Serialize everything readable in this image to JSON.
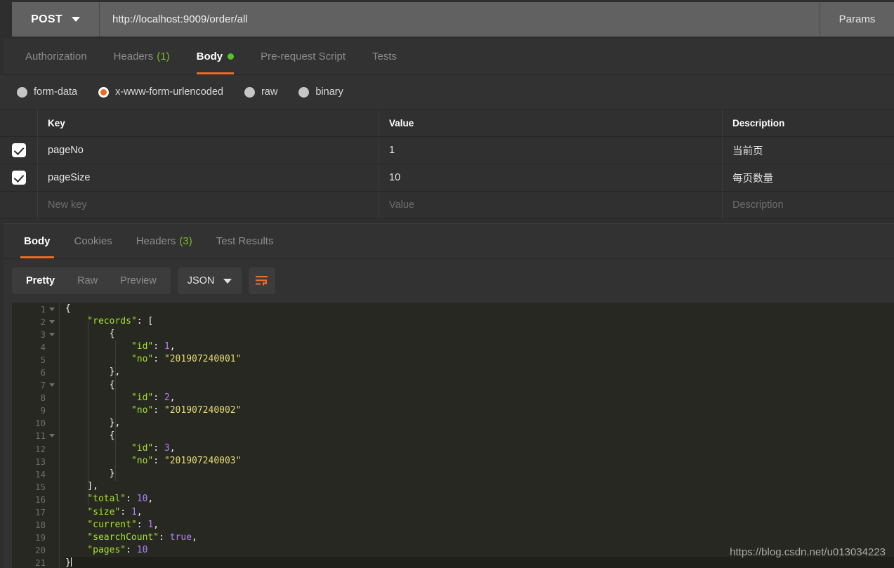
{
  "request_bar": {
    "method": "POST",
    "method_chevron_icon": "chevron-down-icon",
    "url": "http://localhost:9009/order/all",
    "params_label": "Params"
  },
  "request_tabs": [
    {
      "label": "Authorization",
      "count": "",
      "active": false,
      "dot": false
    },
    {
      "label": "Headers",
      "count": "(1)",
      "active": false,
      "dot": false
    },
    {
      "label": "Body",
      "count": "",
      "active": true,
      "dot": true
    },
    {
      "label": "Pre-request Script",
      "count": "",
      "active": false,
      "dot": false
    },
    {
      "label": "Tests",
      "count": "",
      "active": false,
      "dot": false
    }
  ],
  "body_types": [
    {
      "label": "form-data",
      "selected": false
    },
    {
      "label": "x-www-form-urlencoded",
      "selected": true
    },
    {
      "label": "raw",
      "selected": false
    },
    {
      "label": "binary",
      "selected": false
    }
  ],
  "param_table": {
    "headers": {
      "key": "Key",
      "value": "Value",
      "description": "Description"
    },
    "rows": [
      {
        "checked": true,
        "key": "pageNo",
        "value": "1",
        "description": "当前页"
      },
      {
        "checked": true,
        "key": "pageSize",
        "value": "10",
        "description": "每页数量"
      }
    ],
    "new_row_placeholders": {
      "key": "New key",
      "value": "Value",
      "description": "Description"
    }
  },
  "response_tabs": [
    {
      "label": "Body",
      "count": "",
      "active": true
    },
    {
      "label": "Cookies",
      "count": "",
      "active": false
    },
    {
      "label": "Headers",
      "count": "(3)",
      "active": false
    },
    {
      "label": "Test Results",
      "count": "",
      "active": false
    }
  ],
  "view_toolbar": {
    "modes": [
      {
        "label": "Pretty",
        "active": true
      },
      {
        "label": "Raw",
        "active": false
      },
      {
        "label": "Preview",
        "active": false
      }
    ],
    "format": "JSON",
    "format_chevron_icon": "chevron-down-icon",
    "wrap_icon": "word-wrap-icon"
  },
  "response_body": {
    "lines": [
      {
        "n": 1,
        "fold": true,
        "current": false,
        "tokens": [
          {
            "t": "pun",
            "v": "{"
          }
        ]
      },
      {
        "n": 2,
        "fold": true,
        "current": false,
        "tokens": [
          {
            "t": "pun",
            "v": "    "
          },
          {
            "t": "key",
            "v": "\"records\""
          },
          {
            "t": "pun",
            "v": ": ["
          }
        ]
      },
      {
        "n": 3,
        "fold": true,
        "current": false,
        "tokens": [
          {
            "t": "pun",
            "v": "        {"
          }
        ]
      },
      {
        "n": 4,
        "fold": false,
        "current": false,
        "tokens": [
          {
            "t": "pun",
            "v": "            "
          },
          {
            "t": "key",
            "v": "\"id\""
          },
          {
            "t": "pun",
            "v": ": "
          },
          {
            "t": "num",
            "v": "1"
          },
          {
            "t": "pun",
            "v": ","
          }
        ]
      },
      {
        "n": 5,
        "fold": false,
        "current": false,
        "tokens": [
          {
            "t": "pun",
            "v": "            "
          },
          {
            "t": "key",
            "v": "\"no\""
          },
          {
            "t": "pun",
            "v": ": "
          },
          {
            "t": "str",
            "v": "\"201907240001\""
          }
        ]
      },
      {
        "n": 6,
        "fold": false,
        "current": false,
        "tokens": [
          {
            "t": "pun",
            "v": "        },"
          }
        ]
      },
      {
        "n": 7,
        "fold": true,
        "current": false,
        "tokens": [
          {
            "t": "pun",
            "v": "        {"
          }
        ]
      },
      {
        "n": 8,
        "fold": false,
        "current": false,
        "tokens": [
          {
            "t": "pun",
            "v": "            "
          },
          {
            "t": "key",
            "v": "\"id\""
          },
          {
            "t": "pun",
            "v": ": "
          },
          {
            "t": "num",
            "v": "2"
          },
          {
            "t": "pun",
            "v": ","
          }
        ]
      },
      {
        "n": 9,
        "fold": false,
        "current": false,
        "tokens": [
          {
            "t": "pun",
            "v": "            "
          },
          {
            "t": "key",
            "v": "\"no\""
          },
          {
            "t": "pun",
            "v": ": "
          },
          {
            "t": "str",
            "v": "\"201907240002\""
          }
        ]
      },
      {
        "n": 10,
        "fold": false,
        "current": false,
        "tokens": [
          {
            "t": "pun",
            "v": "        },"
          }
        ]
      },
      {
        "n": 11,
        "fold": true,
        "current": false,
        "tokens": [
          {
            "t": "pun",
            "v": "        {"
          }
        ]
      },
      {
        "n": 12,
        "fold": false,
        "current": false,
        "tokens": [
          {
            "t": "pun",
            "v": "            "
          },
          {
            "t": "key",
            "v": "\"id\""
          },
          {
            "t": "pun",
            "v": ": "
          },
          {
            "t": "num",
            "v": "3"
          },
          {
            "t": "pun",
            "v": ","
          }
        ]
      },
      {
        "n": 13,
        "fold": false,
        "current": false,
        "tokens": [
          {
            "t": "pun",
            "v": "            "
          },
          {
            "t": "key",
            "v": "\"no\""
          },
          {
            "t": "pun",
            "v": ": "
          },
          {
            "t": "str",
            "v": "\"201907240003\""
          }
        ]
      },
      {
        "n": 14,
        "fold": false,
        "current": false,
        "tokens": [
          {
            "t": "pun",
            "v": "        }"
          }
        ]
      },
      {
        "n": 15,
        "fold": false,
        "current": false,
        "tokens": [
          {
            "t": "pun",
            "v": "    ],"
          }
        ]
      },
      {
        "n": 16,
        "fold": false,
        "current": false,
        "tokens": [
          {
            "t": "pun",
            "v": "    "
          },
          {
            "t": "key",
            "v": "\"total\""
          },
          {
            "t": "pun",
            "v": ": "
          },
          {
            "t": "num",
            "v": "10"
          },
          {
            "t": "pun",
            "v": ","
          }
        ]
      },
      {
        "n": 17,
        "fold": false,
        "current": false,
        "tokens": [
          {
            "t": "pun",
            "v": "    "
          },
          {
            "t": "key",
            "v": "\"size\""
          },
          {
            "t": "pun",
            "v": ": "
          },
          {
            "t": "num",
            "v": "1"
          },
          {
            "t": "pun",
            "v": ","
          }
        ]
      },
      {
        "n": 18,
        "fold": false,
        "current": false,
        "tokens": [
          {
            "t": "pun",
            "v": "    "
          },
          {
            "t": "key",
            "v": "\"current\""
          },
          {
            "t": "pun",
            "v": ": "
          },
          {
            "t": "num",
            "v": "1"
          },
          {
            "t": "pun",
            "v": ","
          }
        ]
      },
      {
        "n": 19,
        "fold": false,
        "current": false,
        "tokens": [
          {
            "t": "pun",
            "v": "    "
          },
          {
            "t": "key",
            "v": "\"searchCount\""
          },
          {
            "t": "pun",
            "v": ": "
          },
          {
            "t": "bool",
            "v": "true"
          },
          {
            "t": "pun",
            "v": ","
          }
        ]
      },
      {
        "n": 20,
        "fold": false,
        "current": false,
        "tokens": [
          {
            "t": "pun",
            "v": "    "
          },
          {
            "t": "key",
            "v": "\"pages\""
          },
          {
            "t": "pun",
            "v": ": "
          },
          {
            "t": "num",
            "v": "10"
          }
        ]
      },
      {
        "n": 21,
        "fold": false,
        "current": true,
        "tokens": [
          {
            "t": "pun",
            "v": "}"
          }
        ]
      }
    ],
    "parsed": {
      "records": [
        {
          "id": 1,
          "no": "201907240001"
        },
        {
          "id": 2,
          "no": "201907240002"
        },
        {
          "id": 3,
          "no": "201907240003"
        }
      ],
      "total": 10,
      "size": 1,
      "current": 1,
      "searchCount": true,
      "pages": 10
    }
  },
  "watermark": "https://blog.csdn.net/u013034223",
  "colors": {
    "accent_orange": "#ef6c25",
    "status_green": "#7bb72b",
    "dot_green": "#52c329",
    "editor_bg": "#272822",
    "panel_bg": "#323232",
    "urlbar_bg": "#616161",
    "json_key": "#a6e22e",
    "json_string": "#e6db74",
    "json_number": "#ae81ff"
  }
}
